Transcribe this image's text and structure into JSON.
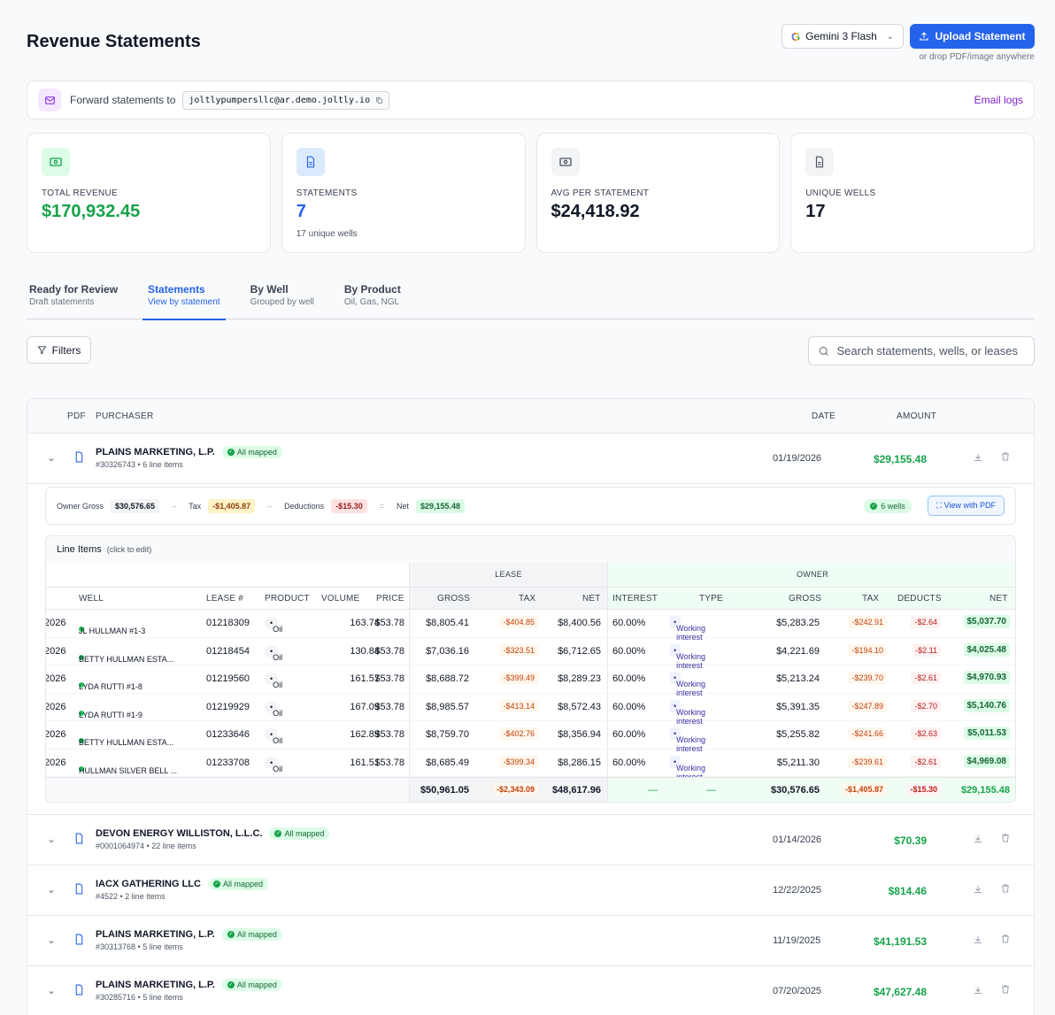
{
  "header": {
    "title": "Revenue Statements",
    "model": "Gemini 3 Flash",
    "upload_label": "Upload Statement",
    "drop_hint": "or drop PDF/image anywhere"
  },
  "forward": {
    "label": "Forward statements to",
    "email": "joltlypumpersllc@ar.demo.joltly.io",
    "logs_label": "Email logs"
  },
  "stats": {
    "total_revenue_label": "TOTAL REVENUE",
    "total_revenue": "$170,932.45",
    "statements_label": "STATEMENTS",
    "statements": "7",
    "statements_sub": "17 unique wells",
    "avg_label": "AVG PER STATEMENT",
    "avg": "$24,418.92",
    "wells_label": "UNIQUE WELLS",
    "wells": "17"
  },
  "tabs": [
    {
      "label": "Ready for Review",
      "sub": "Draft statements"
    },
    {
      "label": "Statements",
      "sub": "View by statement"
    },
    {
      "label": "By Well",
      "sub": "Grouped by well"
    },
    {
      "label": "By Product",
      "sub": "Oil, Gas, NGL"
    }
  ],
  "toolbar": {
    "filters_label": "Filters",
    "search_placeholder": "Search statements, wells, or leases"
  },
  "table_head": {
    "pdf": "PDF",
    "purchaser": "PURCHASER",
    "date": "DATE",
    "amount": "AMOUNT"
  },
  "mapped_label": "All mapped",
  "statements": [
    {
      "purchaser": "PLAINS MARKETING, L.P.",
      "meta": "#30326743 • 6 line items",
      "date": "01/19/2026",
      "amount": "$29,155.48"
    },
    {
      "purchaser": "DEVON ENERGY WILLISTON, L.L.C.",
      "meta": "#0001064974 • 22 line items",
      "date": "01/14/2026",
      "amount": "$70.39"
    },
    {
      "purchaser": "IACX GATHERING LLC",
      "meta": "#4522 • 2 line items",
      "date": "12/22/2025",
      "amount": "$814.46"
    },
    {
      "purchaser": "PLAINS MARKETING, L.P.",
      "meta": "#30313768 • 5 line items",
      "date": "11/19/2025",
      "amount": "$41,191.53"
    },
    {
      "purchaser": "PLAINS MARKETING, L.P.",
      "meta": "#30285716 • 5 line items",
      "date": "07/20/2025",
      "amount": "$47,627.48"
    }
  ],
  "summary": {
    "owner_gross_label": "Owner Gross",
    "owner_gross": "$30,576.65",
    "tax_label": "Tax",
    "tax": "-$1,405.87",
    "deductions_label": "Deductions",
    "deductions": "-$15.30",
    "net_label": "Net",
    "net": "$29,155.48",
    "wells": "6 wells",
    "view_pdf": "View with PDF",
    "op_minus": "–",
    "op_eq": "="
  },
  "line_items": {
    "title": "Line Items",
    "hint": "(click to edit)",
    "group_lease": "LEASE",
    "group_owner": "OWNER",
    "cols": {
      "well": "WELL",
      "lease": "LEASE #",
      "product": "PRODUCT",
      "volume": "VOLUME",
      "price": "PRICE",
      "gross": "GROSS",
      "tax": "TAX",
      "net": "NET",
      "interest": "INTEREST",
      "type": "TYPE",
      "ogross": "GROSS",
      "otax": "TAX",
      "deducts": "DEDUCTS",
      "onet": "NET"
    },
    "rows": [
      {
        "date": "2026",
        "well": "JL HULLMAN #1-3",
        "lease": "01218309",
        "product": "Oil",
        "volume": "163.74",
        "price": "$53.78",
        "gross": "$8,805.41",
        "tax": "-$404.85",
        "net": "$8,400.56",
        "interest": "60.00%",
        "type": "Working interest",
        "ogross": "$5,283.25",
        "otax": "-$242.91",
        "deducts": "-$2.64",
        "onet": "$5,037.70"
      },
      {
        "date": "2026",
        "well": "BETTY HULLMAN ESTA...",
        "lease": "01218454",
        "product": "Oil",
        "volume": "130.84",
        "price": "$53.78",
        "gross": "$7,036.16",
        "tax": "-$323.51",
        "net": "$6,712.65",
        "interest": "60.00%",
        "type": "Working interest",
        "ogross": "$4,221.69",
        "otax": "-$194.10",
        "deducts": "-$2.11",
        "onet": "$4,025.48"
      },
      {
        "date": "2026",
        "well": "LYDA RUTTI #1-8",
        "lease": "01219560",
        "product": "Oil",
        "volume": "161.57",
        "price": "$53.78",
        "gross": "$8,688.72",
        "tax": "-$399.49",
        "net": "$8,289.23",
        "interest": "60.00%",
        "type": "Working interest",
        "ogross": "$5,213.24",
        "otax": "-$239.70",
        "deducts": "-$2.61",
        "onet": "$4,970.93"
      },
      {
        "date": "2026",
        "well": "LYDA RUTTI #1-9",
        "lease": "01219929",
        "product": "Oil",
        "volume": "167.09",
        "price": "$53.78",
        "gross": "$8,985.57",
        "tax": "-$413.14",
        "net": "$8,572.43",
        "interest": "60.00%",
        "type": "Working interest",
        "ogross": "$5,391.35",
        "otax": "-$247.89",
        "deducts": "-$2.70",
        "onet": "$5,140.76"
      },
      {
        "date": "2026",
        "well": "BETTY HULLMAN ESTA...",
        "lease": "01233646",
        "product": "Oil",
        "volume": "162.89",
        "price": "$53.78",
        "gross": "$8,759.70",
        "tax": "-$402.76",
        "net": "$8,356.94",
        "interest": "60.00%",
        "type": "Working interest",
        "ogross": "$5,255.82",
        "otax": "-$241.66",
        "deducts": "-$2.63",
        "onet": "$5,011.53"
      },
      {
        "date": "2026",
        "well": "HULLMAN SILVER BELL ...",
        "lease": "01233708",
        "product": "Oil",
        "volume": "161.51",
        "price": "$53.78",
        "gross": "$8,685.49",
        "tax": "-$399.34",
        "net": "$8,286.15",
        "interest": "60.00%",
        "type": "Working interest",
        "ogross": "$5,211.30",
        "otax": "-$239.61",
        "deducts": "-$2.61",
        "onet": "$4,969.08"
      }
    ],
    "totals": {
      "gross": "$50,961.05",
      "tax": "-$2,343.09",
      "net": "$48,617.96",
      "interest": "—",
      "type": "—",
      "ogross": "$30,576.65",
      "otax": "-$1,405.87",
      "deducts": "-$15.30",
      "onet": "$29,155.48"
    }
  }
}
